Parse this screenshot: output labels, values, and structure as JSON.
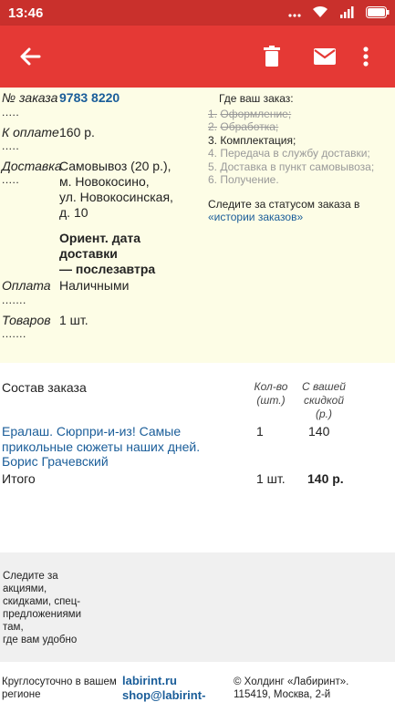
{
  "status_bar": {
    "time": "13:46"
  },
  "order": {
    "number_label": "№ заказа",
    "number_value": "9783 8220",
    "amount_label": "К оплате",
    "amount_value": "160 р.",
    "delivery_label": "Доставка",
    "delivery_lines": [
      "Самовывоз (20 р.),",
      "м. Новокосино,",
      "ул. Новокосинская,",
      "д. 10"
    ],
    "delivery_date_lines": [
      "Ориент. дата",
      "доставки",
      "— послезавтра"
    ],
    "payment_label": "Оплата",
    "payment_value": "Наличными",
    "goods_label": "Товаров",
    "goods_value": "1 шт.",
    "dots_short": ".....",
    "dots_long": "......."
  },
  "tracking": {
    "title": "Где ваш заказ:",
    "steps": [
      {
        "num": "1.",
        "text": "Оформление;"
      },
      {
        "num": "2.",
        "text": "Обработка;"
      },
      {
        "num": "3.",
        "text": "Комплектация;"
      },
      {
        "num": "4.",
        "text": "Передача в службу доставки;"
      },
      {
        "num": "5.",
        "text": "Доставка в пункт самовывоза;"
      },
      {
        "num": "6.",
        "text": "Получение."
      }
    ],
    "follow_text": "Следите за статусом заказа в",
    "follow_link": "«истории заказов»"
  },
  "composition": {
    "title": "Состав заказа",
    "col_qty": [
      "Кол-во",
      "(шт.)"
    ],
    "col_price": [
      "С вашей",
      "скидкой",
      "(р.)"
    ],
    "item_name": "Ералаш. Сюрпри-и-из! Самые прикольные сюжеты наших дней. Борис Грачевский",
    "item_qty": "1",
    "item_price": "140",
    "total_label": "Итого",
    "total_qty": "1 шт.",
    "total_price": "140 р."
  },
  "promo": {
    "text_lines": [
      "Следите за",
      "акциями,",
      "скидками, спец-",
      "предложениями",
      "там,",
      "где вам удобно"
    ]
  },
  "bottom": {
    "hours_lines": [
      "Круглосуточно в вашем",
      "регионе"
    ],
    "site": "labirint.ru",
    "email": "shop@labirint-",
    "copyright_lines": [
      "© Холдинг «Лабиринт».",
      "115419, Москва, 2-й"
    ]
  },
  "colors": {
    "appbar": "#e53935",
    "statusbar": "#c9302c",
    "link": "#1a5d99",
    "order_bg": "#fdfde6"
  }
}
